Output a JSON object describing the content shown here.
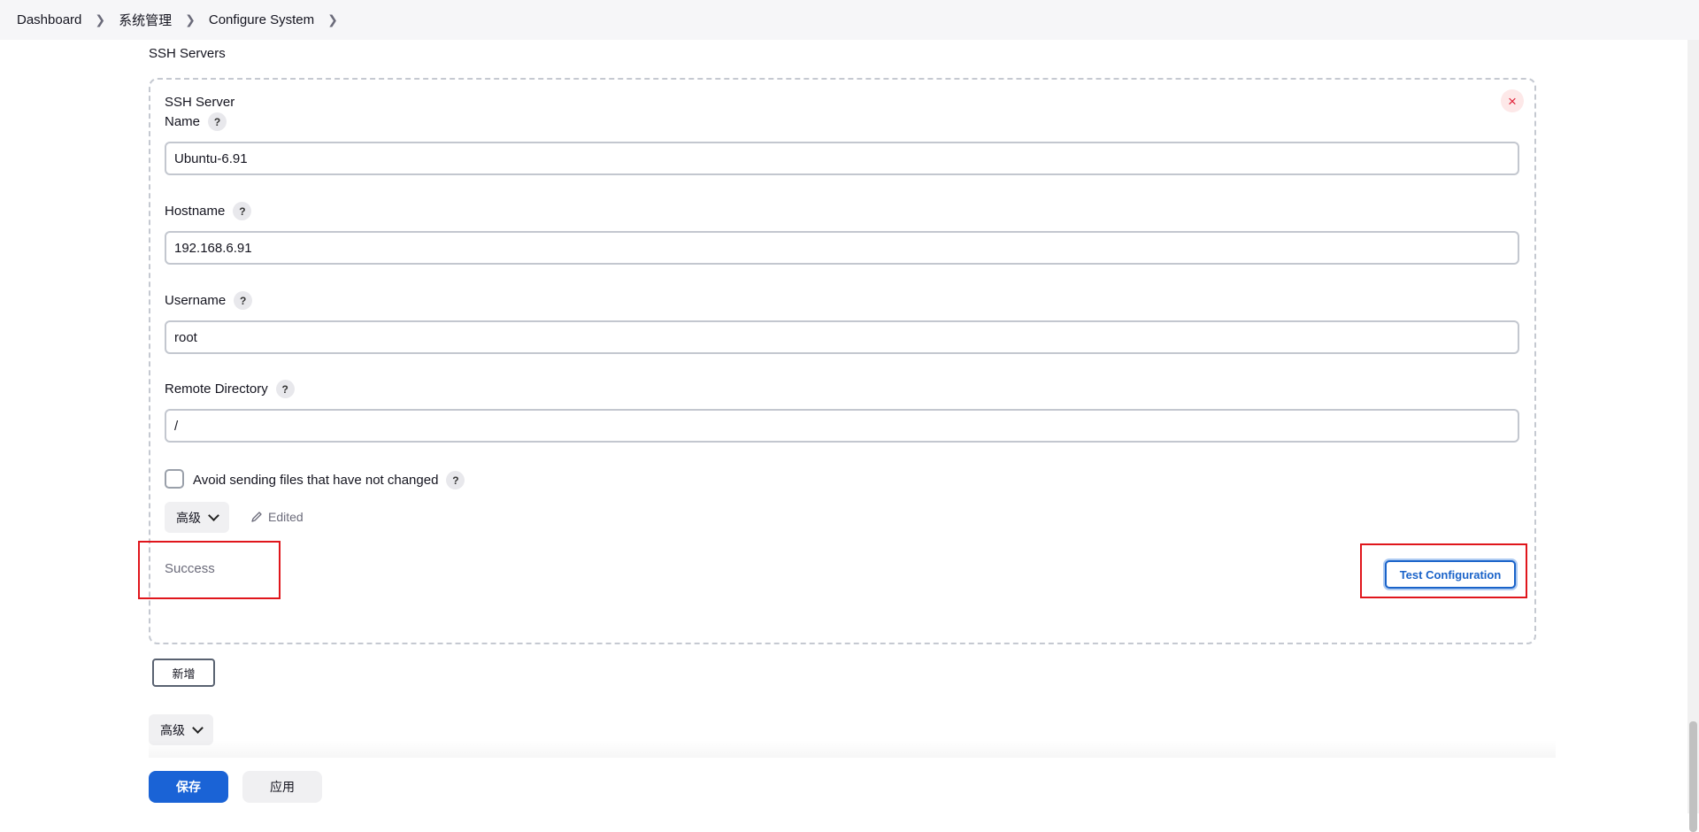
{
  "breadcrumb": {
    "items": [
      "Dashboard",
      "系统管理",
      "Configure System"
    ]
  },
  "section": {
    "title": "SSH Servers"
  },
  "server": {
    "heading": "SSH Server",
    "fields": {
      "name": {
        "label": "Name",
        "value": "Ubuntu-6.91"
      },
      "hostname": {
        "label": "Hostname",
        "value": "192.168.6.91"
      },
      "username": {
        "label": "Username",
        "value": "root"
      },
      "remote_directory": {
        "label": "Remote Directory",
        "value": "/"
      }
    },
    "avoid_sending": {
      "label": "Avoid sending files that have not changed",
      "checked": false
    },
    "advanced_label": "高级",
    "edited_label": "Edited",
    "status_text": "Success",
    "test_button_label": "Test Configuration",
    "help_glyph": "?",
    "close_glyph": "×"
  },
  "add_button_label": "新增",
  "advanced_label": "高级",
  "footer": {
    "save_label": "保存",
    "apply_label": "应用"
  },
  "colors": {
    "primary": "#1a63d6",
    "highlight": "#e0161c",
    "danger": "#e0243a"
  },
  "icons": {
    "separator": "chevron-right-icon",
    "help": "help-icon",
    "close": "close-icon",
    "edited": "pencil-icon",
    "dropdown": "chevron-down-icon"
  }
}
